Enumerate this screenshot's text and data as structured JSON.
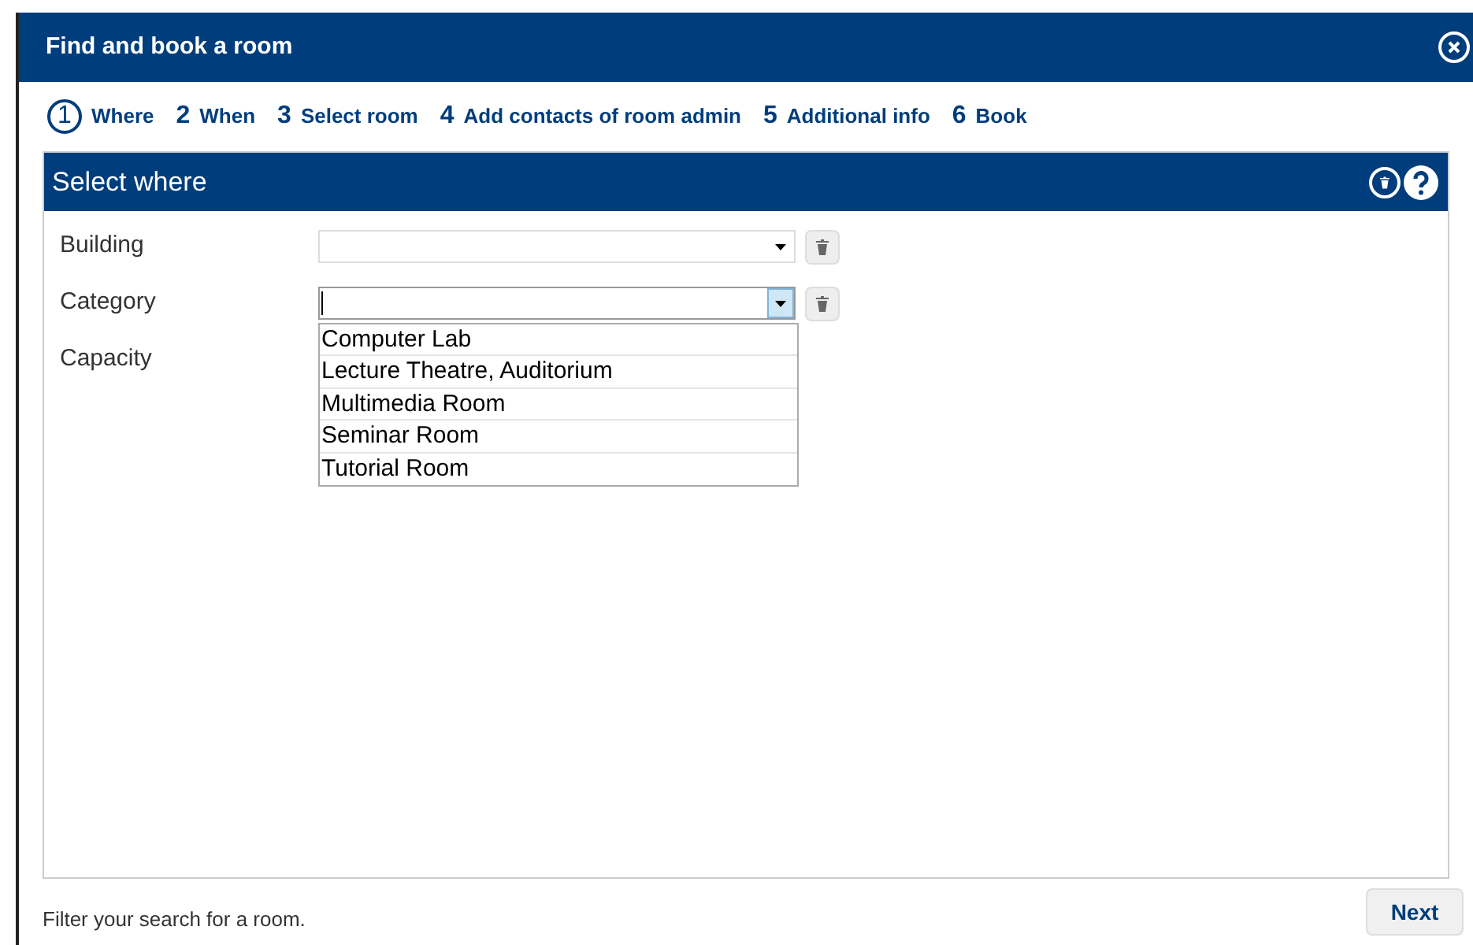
{
  "window": {
    "title": "Find and book a room"
  },
  "steps": [
    {
      "number": "1",
      "label": "Where",
      "selected": true
    },
    {
      "number": "2",
      "label": "When",
      "selected": false
    },
    {
      "number": "3",
      "label": "Select room",
      "selected": false
    },
    {
      "number": "4",
      "label": "Add contacts of room admin",
      "selected": false
    },
    {
      "number": "5",
      "label": "Additional info",
      "selected": false
    },
    {
      "number": "6",
      "label": "Book",
      "selected": false
    }
  ],
  "panel": {
    "title": "Select where"
  },
  "fields": [
    {
      "label": "Building",
      "kind": "select",
      "open": false
    },
    {
      "label": "Category",
      "kind": "select",
      "open": true,
      "options": [
        "Computer Lab",
        "Lecture Theatre, Auditorium",
        "Multimedia Room",
        "Seminar Room",
        "Tutorial Room"
      ]
    },
    {
      "label": "Capacity",
      "kind": "covered"
    }
  ],
  "footer": {
    "hint": "Filter your search for a room.",
    "button": "Next"
  }
}
